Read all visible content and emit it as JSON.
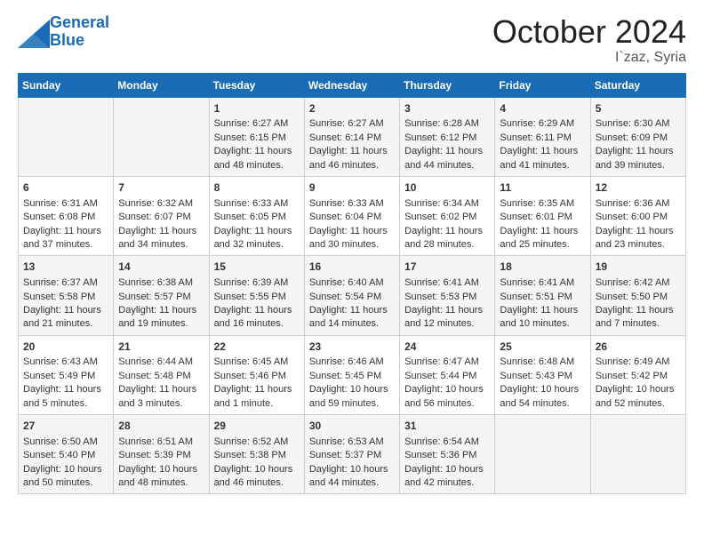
{
  "header": {
    "logo_line1": "General",
    "logo_line2": "Blue",
    "title": "October 2024",
    "subtitle": "I`zaz, Syria"
  },
  "columns": [
    "Sunday",
    "Monday",
    "Tuesday",
    "Wednesday",
    "Thursday",
    "Friday",
    "Saturday"
  ],
  "weeks": [
    [
      {
        "day": "",
        "text": ""
      },
      {
        "day": "",
        "text": ""
      },
      {
        "day": "1",
        "text": "Sunrise: 6:27 AM\nSunset: 6:15 PM\nDaylight: 11 hours and 48 minutes."
      },
      {
        "day": "2",
        "text": "Sunrise: 6:27 AM\nSunset: 6:14 PM\nDaylight: 11 hours and 46 minutes."
      },
      {
        "day": "3",
        "text": "Sunrise: 6:28 AM\nSunset: 6:12 PM\nDaylight: 11 hours and 44 minutes."
      },
      {
        "day": "4",
        "text": "Sunrise: 6:29 AM\nSunset: 6:11 PM\nDaylight: 11 hours and 41 minutes."
      },
      {
        "day": "5",
        "text": "Sunrise: 6:30 AM\nSunset: 6:09 PM\nDaylight: 11 hours and 39 minutes."
      }
    ],
    [
      {
        "day": "6",
        "text": "Sunrise: 6:31 AM\nSunset: 6:08 PM\nDaylight: 11 hours and 37 minutes."
      },
      {
        "day": "7",
        "text": "Sunrise: 6:32 AM\nSunset: 6:07 PM\nDaylight: 11 hours and 34 minutes."
      },
      {
        "day": "8",
        "text": "Sunrise: 6:33 AM\nSunset: 6:05 PM\nDaylight: 11 hours and 32 minutes."
      },
      {
        "day": "9",
        "text": "Sunrise: 6:33 AM\nSunset: 6:04 PM\nDaylight: 11 hours and 30 minutes."
      },
      {
        "day": "10",
        "text": "Sunrise: 6:34 AM\nSunset: 6:02 PM\nDaylight: 11 hours and 28 minutes."
      },
      {
        "day": "11",
        "text": "Sunrise: 6:35 AM\nSunset: 6:01 PM\nDaylight: 11 hours and 25 minutes."
      },
      {
        "day": "12",
        "text": "Sunrise: 6:36 AM\nSunset: 6:00 PM\nDaylight: 11 hours and 23 minutes."
      }
    ],
    [
      {
        "day": "13",
        "text": "Sunrise: 6:37 AM\nSunset: 5:58 PM\nDaylight: 11 hours and 21 minutes."
      },
      {
        "day": "14",
        "text": "Sunrise: 6:38 AM\nSunset: 5:57 PM\nDaylight: 11 hours and 19 minutes."
      },
      {
        "day": "15",
        "text": "Sunrise: 6:39 AM\nSunset: 5:55 PM\nDaylight: 11 hours and 16 minutes."
      },
      {
        "day": "16",
        "text": "Sunrise: 6:40 AM\nSunset: 5:54 PM\nDaylight: 11 hours and 14 minutes."
      },
      {
        "day": "17",
        "text": "Sunrise: 6:41 AM\nSunset: 5:53 PM\nDaylight: 11 hours and 12 minutes."
      },
      {
        "day": "18",
        "text": "Sunrise: 6:41 AM\nSunset: 5:51 PM\nDaylight: 11 hours and 10 minutes."
      },
      {
        "day": "19",
        "text": "Sunrise: 6:42 AM\nSunset: 5:50 PM\nDaylight: 11 hours and 7 minutes."
      }
    ],
    [
      {
        "day": "20",
        "text": "Sunrise: 6:43 AM\nSunset: 5:49 PM\nDaylight: 11 hours and 5 minutes."
      },
      {
        "day": "21",
        "text": "Sunrise: 6:44 AM\nSunset: 5:48 PM\nDaylight: 11 hours and 3 minutes."
      },
      {
        "day": "22",
        "text": "Sunrise: 6:45 AM\nSunset: 5:46 PM\nDaylight: 11 hours and 1 minute."
      },
      {
        "day": "23",
        "text": "Sunrise: 6:46 AM\nSunset: 5:45 PM\nDaylight: 10 hours and 59 minutes."
      },
      {
        "day": "24",
        "text": "Sunrise: 6:47 AM\nSunset: 5:44 PM\nDaylight: 10 hours and 56 minutes."
      },
      {
        "day": "25",
        "text": "Sunrise: 6:48 AM\nSunset: 5:43 PM\nDaylight: 10 hours and 54 minutes."
      },
      {
        "day": "26",
        "text": "Sunrise: 6:49 AM\nSunset: 5:42 PM\nDaylight: 10 hours and 52 minutes."
      }
    ],
    [
      {
        "day": "27",
        "text": "Sunrise: 6:50 AM\nSunset: 5:40 PM\nDaylight: 10 hours and 50 minutes."
      },
      {
        "day": "28",
        "text": "Sunrise: 6:51 AM\nSunset: 5:39 PM\nDaylight: 10 hours and 48 minutes."
      },
      {
        "day": "29",
        "text": "Sunrise: 6:52 AM\nSunset: 5:38 PM\nDaylight: 10 hours and 46 minutes."
      },
      {
        "day": "30",
        "text": "Sunrise: 6:53 AM\nSunset: 5:37 PM\nDaylight: 10 hours and 44 minutes."
      },
      {
        "day": "31",
        "text": "Sunrise: 6:54 AM\nSunset: 5:36 PM\nDaylight: 10 hours and 42 minutes."
      },
      {
        "day": "",
        "text": ""
      },
      {
        "day": "",
        "text": ""
      }
    ]
  ]
}
